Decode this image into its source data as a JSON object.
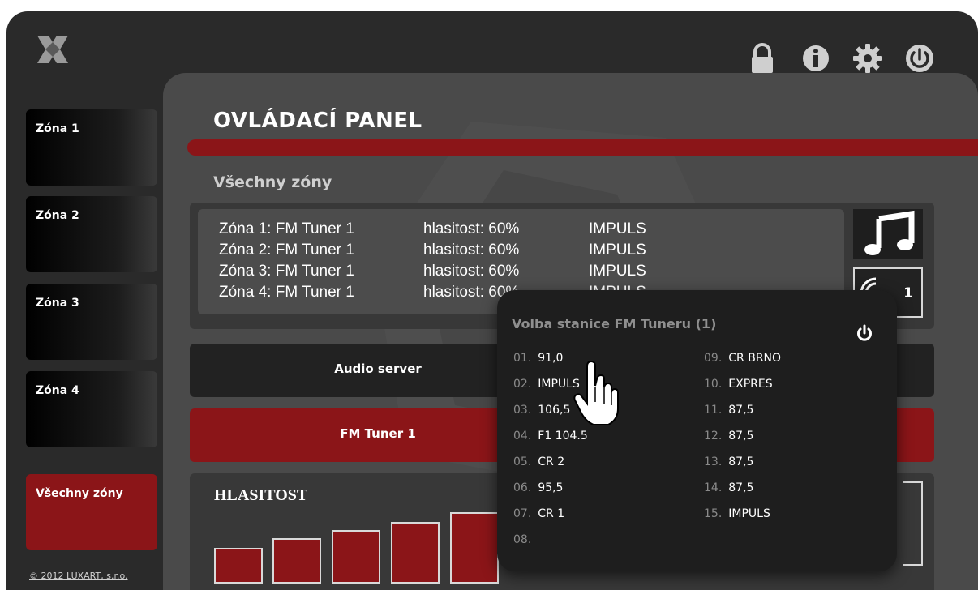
{
  "header": {
    "icons": [
      "logo-icon",
      "lock-icon",
      "info-icon",
      "settings-icon",
      "power-icon"
    ]
  },
  "sidebar": {
    "items": [
      {
        "label": "Zóna 1"
      },
      {
        "label": "Zóna 2"
      },
      {
        "label": "Zóna 3"
      },
      {
        "label": "Zóna 4"
      },
      {
        "label": "Všechny zóny",
        "active": true
      }
    ],
    "copyright": "© 2012 LUXART, s.r.o."
  },
  "main": {
    "title": "OVLÁDACÍ PANEL",
    "section_title": "Všechny zóny",
    "zones": [
      {
        "name": "Zóna 1: FM Tuner 1",
        "volume": "hlasitost: 60%",
        "station": "IMPULS"
      },
      {
        "name": "Zóna 2: FM Tuner 1",
        "volume": "hlasitost: 60%",
        "station": "IMPULS"
      },
      {
        "name": "Zóna 3: FM Tuner 1",
        "volume": "hlasitost: 60%",
        "station": "IMPULS"
      },
      {
        "name": "Zóna 4: FM Tuner 1",
        "volume": "hlasitost: 60%",
        "station": "IMPULS"
      }
    ],
    "tuner_number": "1",
    "sources": [
      {
        "label": "Audio server"
      },
      {
        "label": "FM Tuner 1",
        "active": true
      }
    ],
    "volume_title": "HLASITOST"
  },
  "popup": {
    "title": "Volba stanice FM Tuneru (1)",
    "stations": [
      {
        "num": "01.",
        "name": "91,0"
      },
      {
        "num": "02.",
        "name": "IMPULS"
      },
      {
        "num": "03.",
        "name": "106,5"
      },
      {
        "num": "04.",
        "name": "F1 104.5"
      },
      {
        "num": "05.",
        "name": "CR 2"
      },
      {
        "num": "06.",
        "name": "95,5"
      },
      {
        "num": "07.",
        "name": "CR 1"
      },
      {
        "num": "08.",
        "name": ""
      },
      {
        "num": "09.",
        "name": "CR BRNO"
      },
      {
        "num": "10.",
        "name": "EXPRES"
      },
      {
        "num": "11.",
        "name": "87,5"
      },
      {
        "num": "12.",
        "name": "87,5"
      },
      {
        "num": "13.",
        "name": "87,5"
      },
      {
        "num": "14.",
        "name": "87,5"
      },
      {
        "num": "15.",
        "name": "IMPULS"
      }
    ]
  },
  "colors": {
    "accent": "#8b1518",
    "panel": "#4a4a4a",
    "frame": "#2a2a2a"
  }
}
